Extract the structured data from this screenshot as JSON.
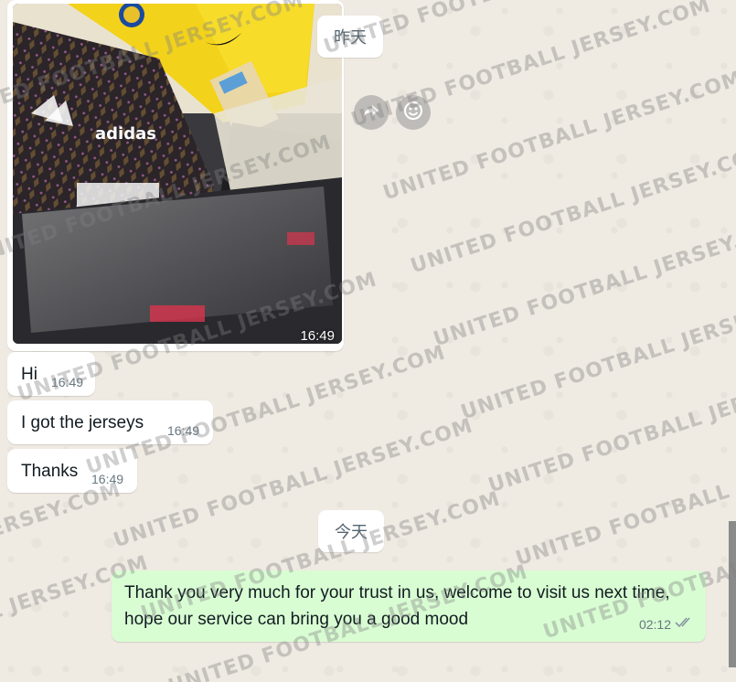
{
  "chat": {
    "date_yesterday": "昨天",
    "date_today": "今天",
    "photo_time": "16:49",
    "messages_in": [
      {
        "text": "Hi",
        "time": "16:49"
      },
      {
        "text": "I got the jerseys",
        "time": "16:49"
      },
      {
        "text": "Thanks",
        "time": "16:49"
      }
    ],
    "message_out": {
      "text": "Thank you very much for your trust in us, welcome to visit us next time, hope our service can bring you a good mood",
      "time": "02:12",
      "status_icon": "double-check-icon"
    }
  },
  "photo": {
    "brand_text": "adidas"
  },
  "watermark": {
    "text": "UNITED FOOTBALL JERSEY.COM"
  },
  "colors": {
    "chat_background": "#efeae2",
    "incoming_bubble": "#ffffff",
    "outgoing_bubble": "#d9fdd3",
    "timestamp": "#667781",
    "read_ticks": "#8696a0"
  },
  "icons": {
    "forward": "forward-icon",
    "emoji": "emoji-icon"
  }
}
